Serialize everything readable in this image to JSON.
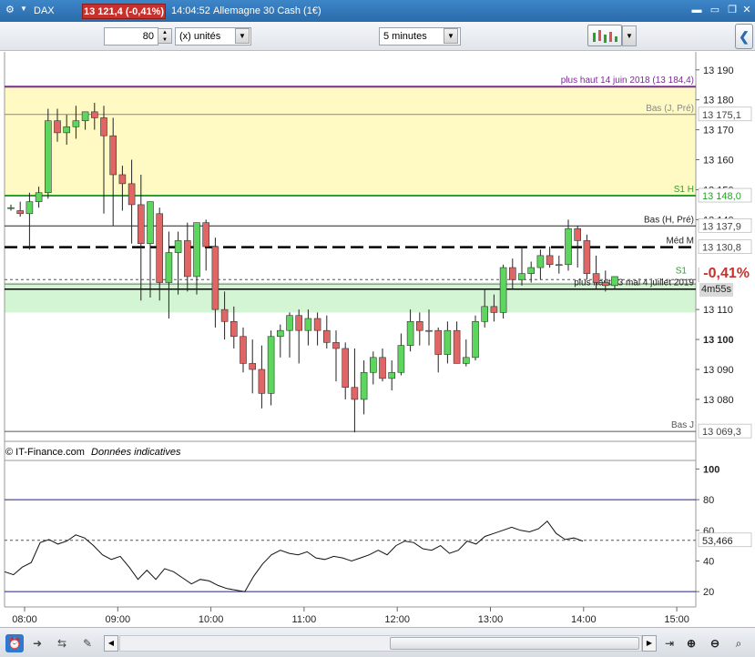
{
  "titlebar": {
    "symbol": "DAX",
    "price_badge": "13 121,4 (-0,41%)",
    "time": "14:04:52",
    "instrument": "Allemagne 30 Cash (1€)"
  },
  "toolbar": {
    "units_value": "80",
    "units_label": "(x) unités",
    "timeframe": "5 minutes"
  },
  "chart": {
    "source": "© IT-Finance.com",
    "notice": "Données indicatives",
    "price_axis": [
      "13 190",
      "13 180",
      "13 170",
      "13 160",
      "13 150",
      "13 140",
      "13 110",
      "13 100",
      "13 090",
      "13 080"
    ],
    "price_axis_values": [
      13190,
      13180,
      13170,
      13160,
      13150,
      13140,
      13110,
      13100,
      13090,
      13080
    ],
    "price_tags": [
      {
        "label": "13 184,4",
        "value": 13184.4,
        "color": "#7a2b94",
        "text": "plus haut 14 juin 2018 (13 184,4)",
        "tag": false
      },
      {
        "label": "13 175,1",
        "value": 13175.1,
        "color": "#888888",
        "text": "Bas (J, Pré)",
        "tag": true
      },
      {
        "label": "13 148,0",
        "value": 13148.0,
        "color": "#2ca02c",
        "text": "S1 H",
        "tag": true
      },
      {
        "label": "13 137,9",
        "value": 13137.9,
        "color": "#222222",
        "text": "Bas (H, Pré)",
        "tag": true
      },
      {
        "label": "13 130,8",
        "value": 13130.8,
        "color": "#000000",
        "text": "Méd M",
        "tag": true
      },
      {
        "label": "13 069,3",
        "value": 13069.3,
        "color": "#555555",
        "text": "Bas J",
        "tag": true
      }
    ],
    "current_price": "13 121,4",
    "change_pct": "-0,41%",
    "countdown": "4m55s",
    "annotation_low": "plus hauts 3 mai 4 juillet 2019",
    "s1_label": "S1",
    "time_axis": [
      "08:00",
      "09:00",
      "10:00",
      "11:00",
      "12:00",
      "13:00",
      "14:00",
      "15:00"
    ],
    "colors": {
      "up": "#5cd65c",
      "down": "#e06666",
      "band_yellow": "#fff9c4",
      "band_green": "#d4f5d4",
      "price_tag": "#c9302c"
    }
  },
  "chart_data": {
    "type": "candlestick",
    "y_range": [
      13066,
      13196
    ],
    "candles": [
      [
        13144,
        13145,
        13143,
        13144
      ],
      [
        13143,
        13146,
        13141,
        13142
      ],
      [
        13142,
        13149,
        13130,
        13146
      ],
      [
        13146,
        13151,
        13144,
        13149
      ],
      [
        13149,
        13177,
        13147,
        13173
      ],
      [
        13173,
        13177,
        13166,
        13169
      ],
      [
        13169,
        13175,
        13165,
        13171
      ],
      [
        13171,
        13178,
        13167,
        13173
      ],
      [
        13173,
        13176,
        13170,
        13176
      ],
      [
        13176,
        13179,
        13170,
        13174
      ],
      [
        13174,
        13178,
        13142,
        13168
      ],
      [
        13168,
        13174,
        13138,
        13155
      ],
      [
        13155,
        13158,
        13143,
        13152
      ],
      [
        13152,
        13160,
        13132,
        13145
      ],
      [
        13145,
        13155,
        13113,
        13132
      ],
      [
        13132,
        13146,
        13114,
        13146
      ],
      [
        13142,
        13144,
        13113,
        13119
      ],
      [
        13119,
        13136,
        13107,
        13129
      ],
      [
        13129,
        13136,
        13115,
        13133
      ],
      [
        13133,
        13139,
        13116,
        13121
      ],
      [
        13121,
        13139,
        13115,
        13139
      ],
      [
        13139,
        13140,
        13123,
        13131
      ],
      [
        13131,
        13134,
        13104,
        13110
      ],
      [
        13110,
        13116,
        13100,
        13106
      ],
      [
        13106,
        13111,
        13097,
        13101
      ],
      [
        13101,
        13104,
        13089,
        13092
      ],
      [
        13092,
        13100,
        13082,
        13090
      ],
      [
        13090,
        13098,
        13077,
        13082
      ],
      [
        13082,
        13103,
        13078,
        13101
      ],
      [
        13101,
        13105,
        13094,
        13103
      ],
      [
        13103,
        13109,
        13094,
        13108
      ],
      [
        13108,
        13110,
        13092,
        13103
      ],
      [
        13103,
        13110,
        13098,
        13107
      ],
      [
        13107,
        13109,
        13098,
        13103
      ],
      [
        13103,
        13108,
        13097,
        13099
      ],
      [
        13099,
        13103,
        13086,
        13097
      ],
      [
        13097,
        13099,
        13080,
        13084
      ],
      [
        13084,
        13097,
        13069,
        13080
      ],
      [
        13080,
        13093,
        13075,
        13089
      ],
      [
        13089,
        13096,
        13085,
        13094
      ],
      [
        13094,
        13097,
        13086,
        13087
      ],
      [
        13087,
        13093,
        13083,
        13089
      ],
      [
        13089,
        13102,
        13088,
        13098
      ],
      [
        13098,
        13110,
        13096,
        13106
      ],
      [
        13106,
        13109,
        13098,
        13103
      ],
      [
        13103,
        13110,
        13098,
        13103
      ],
      [
        13103,
        13104,
        13089,
        13095
      ],
      [
        13095,
        13106,
        13092,
        13103
      ],
      [
        13103,
        13106,
        13092,
        13092
      ],
      [
        13092,
        13100,
        13091,
        13094
      ],
      [
        13094,
        13108,
        13093,
        13106
      ],
      [
        13106,
        13117,
        13104,
        13111
      ],
      [
        13111,
        13115,
        13106,
        13109
      ],
      [
        13109,
        13125,
        13107,
        13124
      ],
      [
        13124,
        13127,
        13117,
        13120
      ],
      [
        13120,
        13131,
        13118,
        13122
      ],
      [
        13122,
        13126,
        13119,
        13124
      ],
      [
        13124,
        13130,
        13120,
        13128
      ],
      [
        13128,
        13131,
        13124,
        13125
      ],
      [
        13125,
        13128,
        13122,
        13125
      ],
      [
        13125,
        13140,
        13123,
        13137
      ],
      [
        13137,
        13138,
        13124,
        13133
      ],
      [
        13133,
        13135,
        13120,
        13122
      ],
      [
        13122,
        13128,
        13117,
        13119
      ],
      [
        13119,
        13123,
        13116,
        13118
      ],
      [
        13118,
        13121,
        13117,
        13121
      ]
    ],
    "oscillator": {
      "y_range": [
        10,
        105
      ],
      "levels": [
        80,
        20
      ],
      "current": "53,466",
      "axis": [
        "100",
        "80",
        "60",
        "40",
        "20"
      ],
      "axis_values": [
        100,
        80,
        60,
        40,
        20
      ],
      "values": [
        33,
        31,
        36,
        39,
        52,
        54,
        51,
        53,
        57,
        55,
        50,
        44,
        41,
        43,
        36,
        28,
        34,
        28,
        35,
        33,
        29,
        25,
        28,
        27,
        24,
        22,
        21,
        20,
        30,
        38,
        44,
        47,
        45,
        44,
        46,
        42,
        41,
        43,
        42,
        40,
        42,
        44,
        47,
        44,
        50,
        53,
        52,
        48,
        47,
        50,
        45,
        47,
        53,
        51,
        56,
        58,
        60,
        62,
        60,
        59,
        61,
        66,
        58,
        54,
        55,
        53
      ]
    }
  },
  "bottombar": {
    "icons": [
      "alarm-clock-icon",
      "arrow-right-icon",
      "arrows-icon",
      "scroll-left-icon",
      "scroll-right-icon",
      "zoom-in-icon",
      "zoom-out-icon",
      "zoom-fit-icon",
      "scroll-end-icon"
    ]
  }
}
